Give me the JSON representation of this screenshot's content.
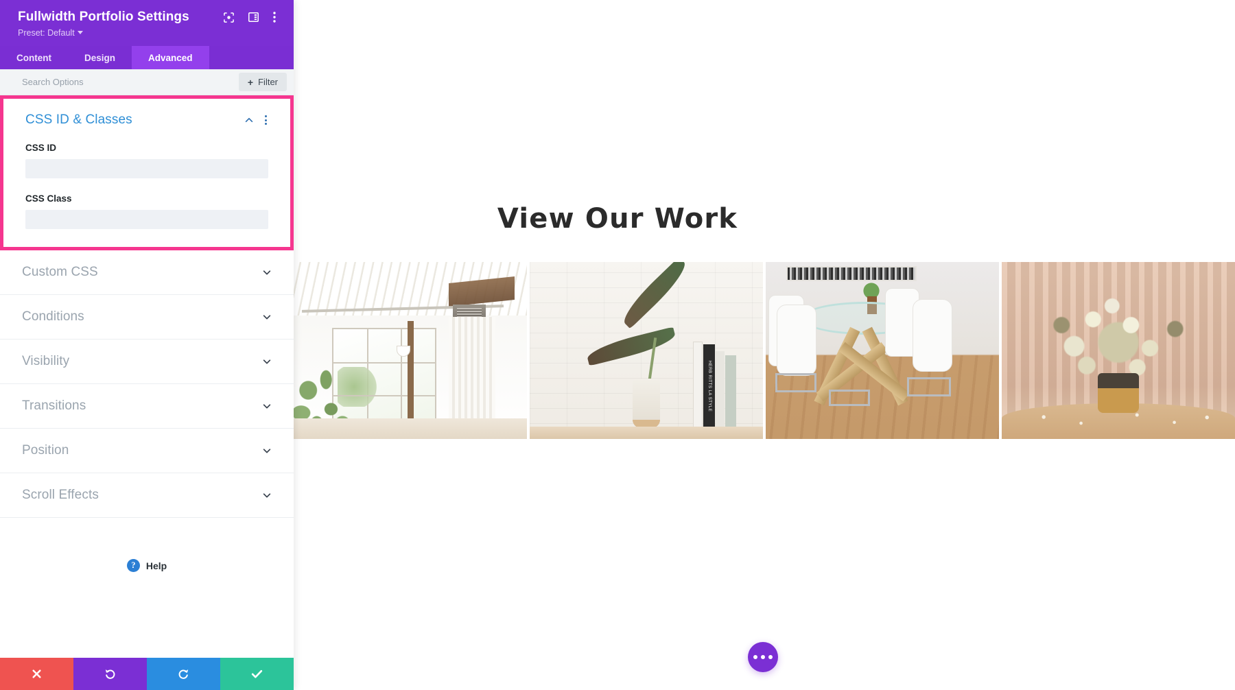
{
  "panel": {
    "title": "Fullwidth Portfolio Settings",
    "preset_label": "Preset: Default",
    "header_icons": [
      {
        "name": "fullscreen-icon",
        "glyph": "expand"
      },
      {
        "name": "layout-columns-icon",
        "glyph": "layout"
      },
      {
        "name": "more-options-icon",
        "glyph": "kebab"
      }
    ],
    "tabs": [
      {
        "label": "Content",
        "active": false
      },
      {
        "label": "Design",
        "active": false
      },
      {
        "label": "Advanced",
        "active": true
      }
    ],
    "search": {
      "placeholder": "Search Options",
      "value": ""
    },
    "filter_button": {
      "label": "Filter",
      "icon": "plus-icon"
    },
    "open_section": {
      "title": "CSS ID & Classes",
      "collapse_icon": "chevron-up-icon",
      "options_icon": "kebab-icon",
      "highlighted": true,
      "highlight_color": "#f5368f",
      "fields": [
        {
          "label": "CSS ID",
          "value": "",
          "placeholder": ""
        },
        {
          "label": "CSS Class",
          "value": "",
          "placeholder": ""
        }
      ]
    },
    "collapsed_sections": [
      {
        "label": "Custom CSS",
        "icon": "chevron-down-icon"
      },
      {
        "label": "Conditions",
        "icon": "chevron-down-icon"
      },
      {
        "label": "Visibility",
        "icon": "chevron-down-icon"
      },
      {
        "label": "Transitions",
        "icon": "chevron-down-icon"
      },
      {
        "label": "Position",
        "icon": "chevron-down-icon"
      },
      {
        "label": "Scroll Effects",
        "icon": "chevron-down-icon"
      }
    ],
    "help": {
      "label": "Help",
      "badge": "?"
    },
    "footer_buttons": [
      {
        "name": "cancel-button",
        "icon": "x-icon",
        "color": "#ef5350"
      },
      {
        "name": "undo-button",
        "icon": "undo-icon",
        "color": "#7b2fd4"
      },
      {
        "name": "redo-button",
        "icon": "redo-icon",
        "color": "#2a8de0"
      },
      {
        "name": "save-button",
        "icon": "check-icon",
        "color": "#2cc49a"
      }
    ],
    "accent_color": "#7b2fd4",
    "section_title_color": "#2f8fd6"
  },
  "canvas": {
    "heading": "View Our Work",
    "portfolio_items": [
      {
        "name": "loft-interior-window",
        "alt": "White loft interior with large window and plant"
      },
      {
        "name": "brick-wall-books",
        "alt": "White brick wall with plant in vase and stacked books"
      },
      {
        "name": "dining-table-chairs",
        "alt": "Glass dining table with white chairs on wood floor"
      },
      {
        "name": "flower-bouquet",
        "alt": "Dried flower bouquet in gold pot against peach curtain"
      }
    ],
    "fab": {
      "name": "page-settings-fab",
      "icon": "ellipsis-icon",
      "color": "#7b2fd4"
    }
  }
}
